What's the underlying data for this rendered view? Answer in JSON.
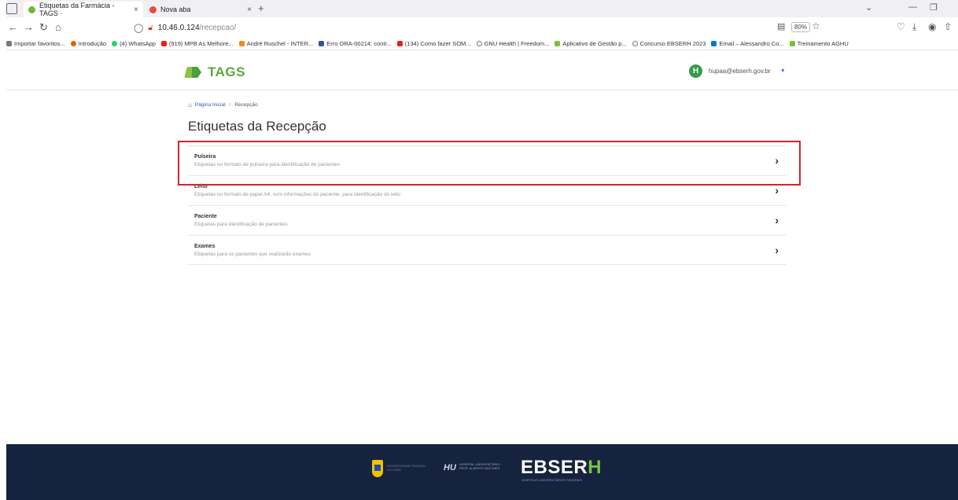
{
  "browser": {
    "tabs": [
      {
        "label": "Etiquetas da Farmácia - TAGS ·",
        "color": "#6fb63b"
      },
      {
        "label": "Nova aba",
        "color": "#e44d3a"
      }
    ],
    "url_host": "10.46.0.124",
    "url_path": "/recepcao/",
    "zoom": "80%",
    "bookmarks": [
      {
        "label": "Importar favoritos...",
        "color": "#777777"
      },
      {
        "label": "Introdução",
        "color": "#e66000"
      },
      {
        "label": "(4) WhatsApp",
        "color": "#25d366"
      },
      {
        "label": "(919) MPB As Melhore...",
        "color": "#e62117"
      },
      {
        "label": "André Ruschel - INTER...",
        "color": "#f08a24"
      },
      {
        "label": "Erro ORA-00214: contr...",
        "color": "#2b5797"
      },
      {
        "label": "(134) Como fazer SOM...",
        "color": "#e62117"
      },
      {
        "label": "GNU Health | Freedom...",
        "color": "#777777"
      },
      {
        "label": "Aplicativo de Gestão p...",
        "color": "#7fbf3f"
      },
      {
        "label": "Concurso EBSERH 2023",
        "color": "#777777"
      },
      {
        "label": "Email – Alessandro Co...",
        "color": "#0078d4"
      },
      {
        "label": "Treinamento AGHU",
        "color": "#7fbf3f"
      }
    ]
  },
  "app": {
    "logo_text": "TAGS",
    "user_initial": "H",
    "user_email": "hupaa@ebserh.gov.br"
  },
  "breadcrumb": {
    "home": "Página Inicial",
    "current": "Recepção"
  },
  "page_title": "Etiquetas da Recepção",
  "items": [
    {
      "title": "Pulseira",
      "desc": "Etiquetas no formato de pulseira para identificação de pacientes"
    },
    {
      "title": "Leito",
      "desc": "Etiquetas no formato de papel A4, com informações do paciente, para identificação do leito"
    },
    {
      "title": "Paciente",
      "desc": "Etiquetas para identificação de pacientes"
    },
    {
      "title": "Exames",
      "desc": "Etiquetas para os pacientes que realizarão exames"
    }
  ],
  "footer": {
    "university": "UNIVERSIDADE FEDERAL DO PARÁ",
    "hospital": "HOSPITAL UNIVERSITÁRIO PROF. ALBERTO ANTUNES",
    "hospital_short": "HU",
    "brand_main": "EBSER",
    "brand_h": "H",
    "brand_sub": "HOSPITAIS UNIVERSITÁRIOS FEDERAIS"
  }
}
